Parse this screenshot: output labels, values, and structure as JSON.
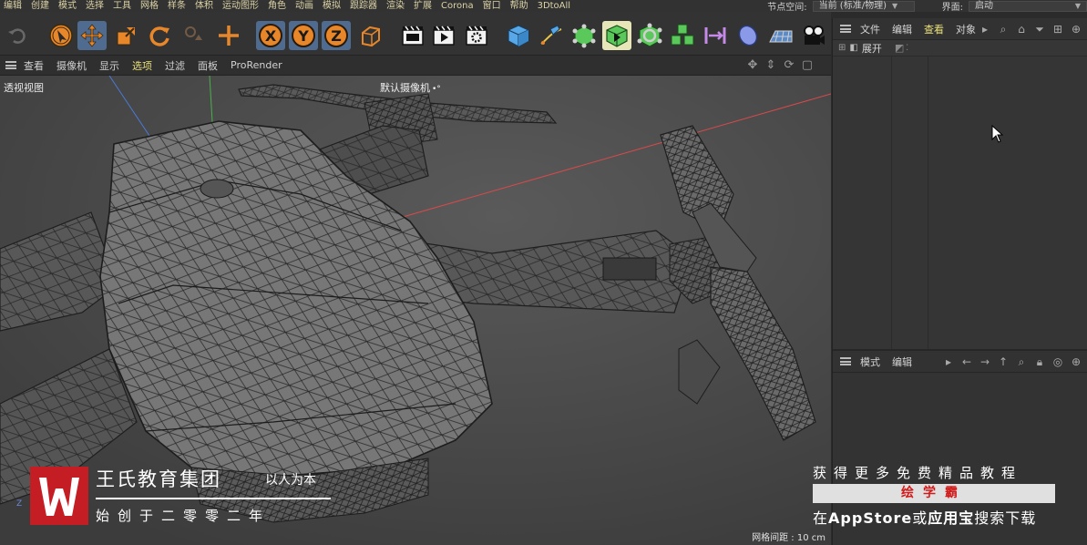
{
  "menubar": {
    "items": [
      "编辑",
      "创建",
      "模式",
      "选择",
      "工具",
      "网格",
      "样条",
      "体积",
      "运动图形",
      "角色",
      "动画",
      "模拟",
      "跟踪器",
      "渲染",
      "扩展",
      "Corona",
      "窗口",
      "帮助",
      "3DtoAll"
    ],
    "node_space_label": "节点空间:",
    "node_space_value": "当前 (标准/物理)",
    "interface_label": "界面:",
    "interface_value": "启动"
  },
  "toolbar": {
    "tools": [
      "undo-icon",
      "select-icon",
      "move-icon",
      "scale-icon",
      "rotate-icon",
      "last-tool-icon",
      "add-object-icon",
      "x-axis-icon",
      "y-axis-icon",
      "z-axis-icon",
      "coordinate-system-icon",
      "render-view-icon",
      "render-queue-icon",
      "render-settings-icon",
      "cube-icon",
      "pen-icon",
      "subdivision-icon",
      "generator-icon",
      "deformer-icon",
      "array-icon",
      "symmetry-icon",
      "field-icon",
      "floor-icon",
      "camera-icon"
    ]
  },
  "viewport": {
    "menu": [
      "查看",
      "摄像机",
      "显示",
      "选项",
      "过滤",
      "面板",
      "ProRender"
    ],
    "highlighted": "选项",
    "title": "透视视图",
    "camera": "默认摄像机",
    "grid_distance": "网格间距 : 10 cm",
    "axis_labels": {
      "z": "Z"
    }
  },
  "object_panel": {
    "menu": [
      "文件",
      "编辑",
      "查看",
      "对象"
    ],
    "highlighted": "查看",
    "expand_label": "展开"
  },
  "attr_panel": {
    "menu": [
      "模式",
      "编辑"
    ]
  },
  "watermark": {
    "company": "王氏教育集团",
    "slogan": "以人为本",
    "founded": "始创于二零零二年",
    "right_line1": "获得更多免费精品教程",
    "right_brand": "绘学霸",
    "right_line3_pre": "在",
    "right_line3_store": "AppStore",
    "right_line3_or": "或",
    "right_line3_app": "应用宝",
    "right_line3_post": "搜索下载"
  },
  "colors": {
    "accent": "#e8e07a",
    "red_axis": "#d84a4a",
    "green_axis": "#4ab04a",
    "blue_axis": "#4a7ad8",
    "brand_red": "#c41e24"
  }
}
